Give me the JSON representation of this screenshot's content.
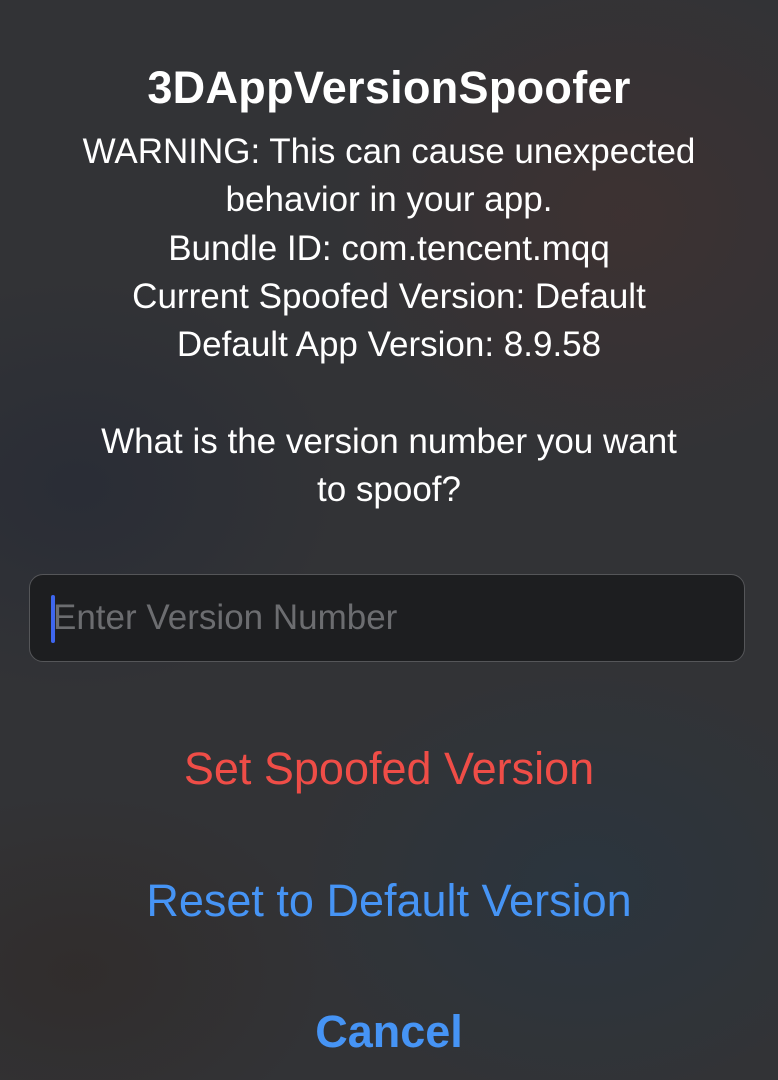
{
  "alert": {
    "title": "3DAppVersionSpoofer",
    "message": {
      "warning_line1": "WARNING: This can cause unexpected",
      "warning_line2": "behavior in your app.",
      "bundle_id": "Bundle ID: com.tencent.mqq",
      "current_spoofed": "Current Spoofed Version: Default",
      "default_version": "Default App Version: 8.9.58",
      "question_line1": "What is the version number you want",
      "question_line2": "to spoof?"
    },
    "input": {
      "value": "",
      "placeholder": "Enter Version Number"
    },
    "actions": {
      "set_label": "Set Spoofed Version",
      "reset_label": "Reset to Default Version",
      "cancel_label": "Cancel"
    }
  },
  "colors": {
    "destructive": "#ef4d47",
    "accent": "#4694f5",
    "caret": "#3e66ee"
  }
}
